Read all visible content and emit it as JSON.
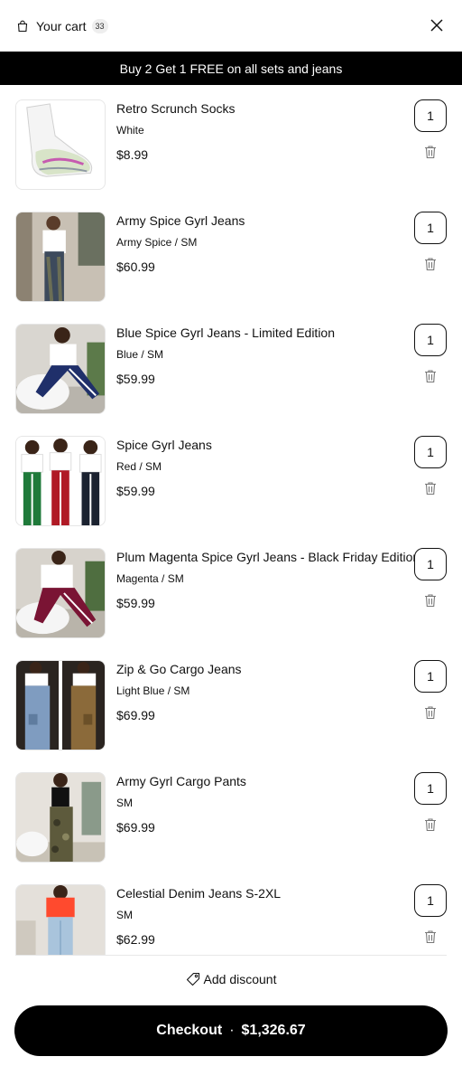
{
  "header": {
    "title": "Your cart",
    "count": "33",
    "bag_icon": "shopping-bag-icon",
    "close_icon": "close-icon"
  },
  "banner": {
    "text": "Buy 2 Get 1 FREE on all sets and jeans"
  },
  "items": [
    {
      "name": "Retro Scrunch Socks",
      "variant": "White",
      "price": "$8.99",
      "qty": "1"
    },
    {
      "name": "Army Spice Gyrl Jeans",
      "variant": "Army Spice / SM",
      "price": "$60.99",
      "qty": "1"
    },
    {
      "name": "Blue Spice Gyrl Jeans - Limited Edition",
      "variant": "Blue / SM",
      "price": "$59.99",
      "qty": "1"
    },
    {
      "name": "Spice Gyrl Jeans",
      "variant": "Red / SM",
      "price": "$59.99",
      "qty": "1"
    },
    {
      "name": "Plum Magenta Spice Gyrl Jeans - Black Friday Edition",
      "variant": "Magenta / SM",
      "price": "$59.99",
      "qty": "1"
    },
    {
      "name": "Zip & Go Cargo Jeans",
      "variant": "Light Blue / SM",
      "price": "$69.99",
      "qty": "1"
    },
    {
      "name": "Army Gyrl Cargo Pants",
      "variant": "SM",
      "price": "$69.99",
      "qty": "1"
    },
    {
      "name": "Celestial Denim Jeans S-2XL",
      "variant": "SM",
      "price": "$62.99",
      "qty": "1"
    }
  ],
  "discount": {
    "label": "Add discount",
    "icon": "tag-icon"
  },
  "checkout": {
    "label": "Checkout",
    "separator": "·",
    "total": "$1,326.67"
  },
  "colors": {
    "banner_bg": "#000000",
    "checkout_bg": "#000000",
    "text": "#111111"
  }
}
